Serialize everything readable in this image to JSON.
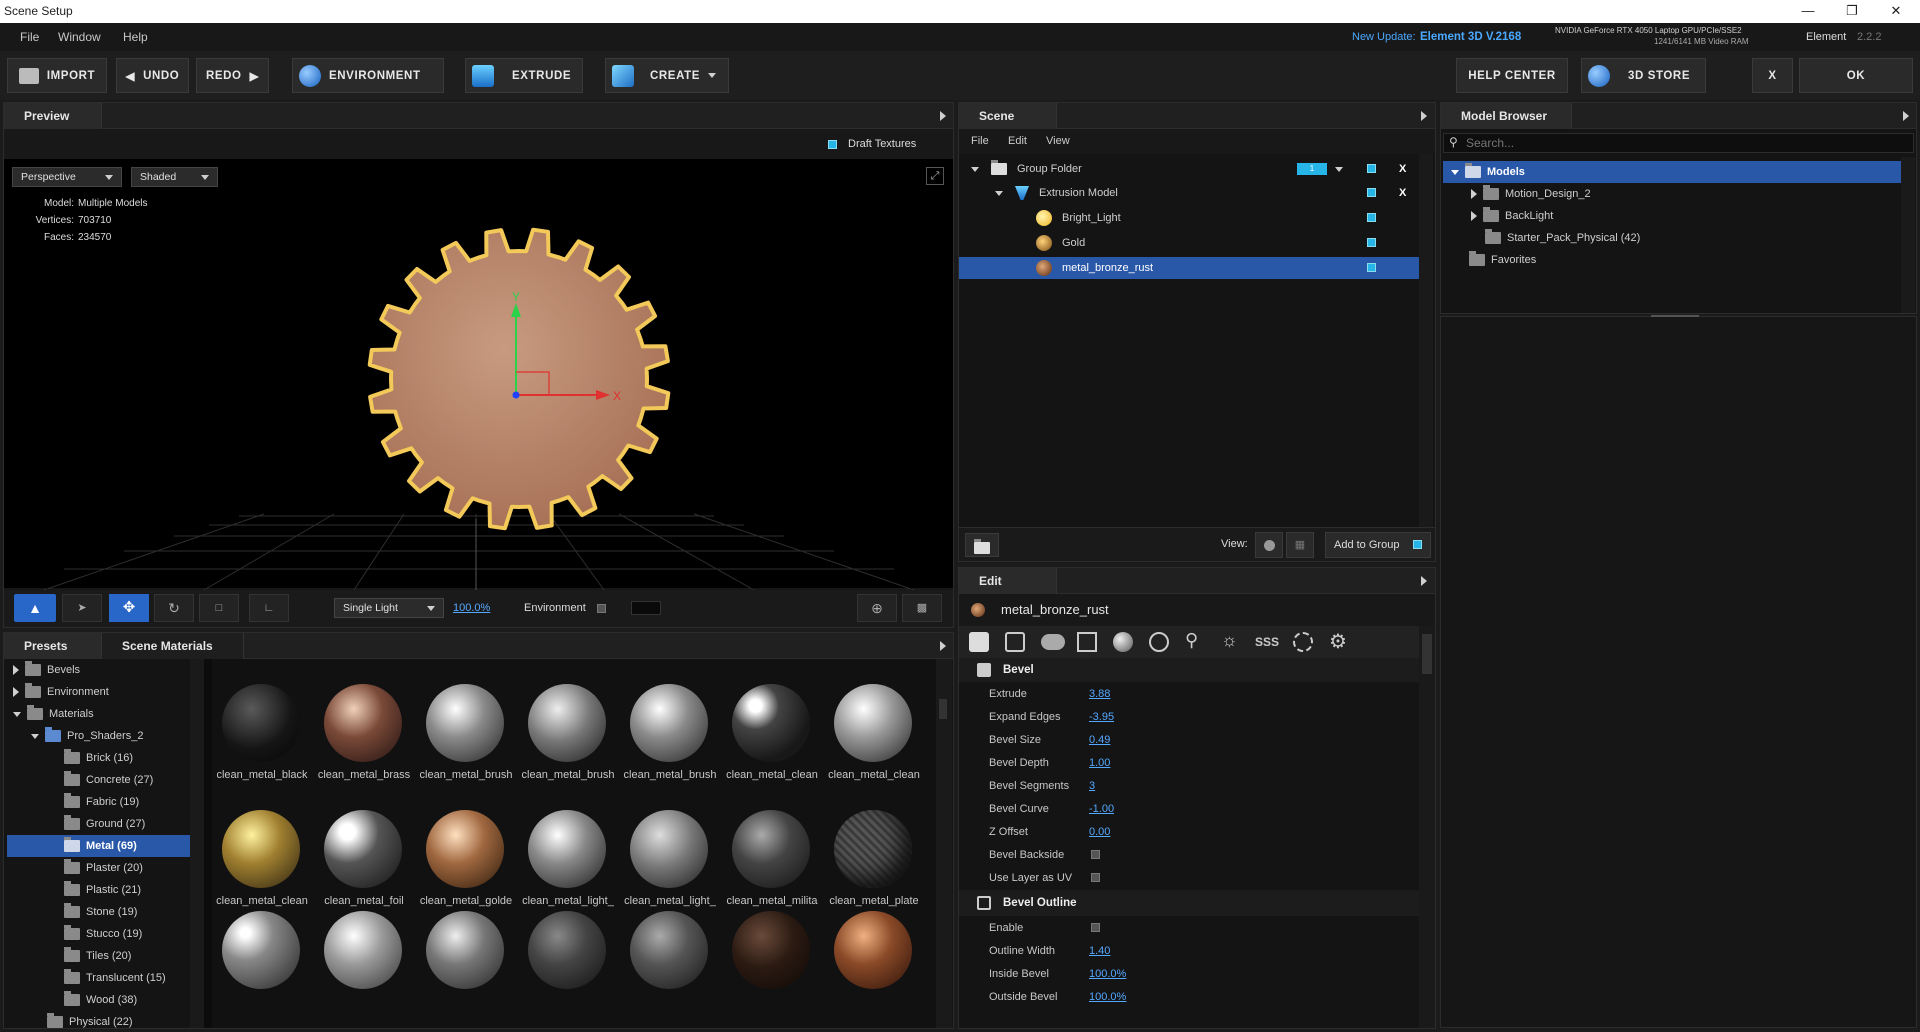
{
  "window": {
    "title": "Scene Setup"
  },
  "menu": {
    "items": [
      "File",
      "Window",
      "Help"
    ]
  },
  "update": {
    "label": "New Update:",
    "version": "Element 3D V.2168"
  },
  "gpu": {
    "line1": "NVIDIA GeForce RTX 4050 Laptop GPU/PCIe/SSE2",
    "line2": "1241/6141 MB Video RAM"
  },
  "app": {
    "name": "Element",
    "version": "2.2.2"
  },
  "toolbar": {
    "import": "IMPORT",
    "undo": "UNDO",
    "redo": "REDO",
    "environment": "ENVIRONMENT",
    "extrude": "EXTRUDE",
    "create": "CREATE",
    "help_center": "HELP CENTER",
    "store": "3D STORE",
    "close": "X",
    "ok": "OK"
  },
  "preview": {
    "tab": "Preview",
    "draft_textures": "Draft Textures",
    "camera": "Perspective",
    "shading": "Shaded",
    "model_label": "Model:",
    "model_value": "Multiple Models",
    "vertices_label": "Vertices:",
    "vertices_value": "703710",
    "faces_label": "Faces:",
    "faces_value": "234570",
    "axis_x": "X",
    "axis_y": "Y",
    "light_mode": "Single Light",
    "light_pct": "100.0%",
    "environment": "Environment"
  },
  "scene": {
    "tab": "Scene",
    "menu": [
      "File",
      "Edit",
      "View"
    ],
    "rows": [
      {
        "label": "Group Folder",
        "group_num": "1"
      },
      {
        "label": "Extrusion Model"
      },
      {
        "label": "Bright_Light"
      },
      {
        "label": "Gold"
      },
      {
        "label": "metal_bronze_rust"
      }
    ],
    "view_label": "View:",
    "add_to_group": "Add to Group"
  },
  "model_browser": {
    "tab": "Model Browser",
    "search_placeholder": "Search...",
    "items": [
      "Models",
      "Motion_Design_2",
      "BackLight",
      "Starter_Pack_Physical (42)",
      "Favorites"
    ]
  },
  "presets": {
    "tabs": [
      "Presets",
      "Scene Materials"
    ],
    "tree": [
      "Bevels",
      "Environment",
      "Materials",
      "Pro_Shaders_2",
      "Brick (16)",
      "Concrete (27)",
      "Fabric (19)",
      "Ground (27)",
      "Metal (69)",
      "Plaster (20)",
      "Plastic (21)",
      "Stone (19)",
      "Stucco (19)",
      "Tiles (20)",
      "Translucent (15)",
      "Wood (38)",
      "Physical (22)"
    ],
    "materials_row1": [
      "clean_metal_black",
      "clean_metal_brass",
      "clean_metal_brush",
      "clean_metal_brush",
      "clean_metal_brush",
      "clean_metal_clean",
      "clean_metal_clean"
    ],
    "materials_row2": [
      "clean_metal_clean",
      "clean_metal_foil",
      "clean_metal_golde",
      "clean_metal_light_",
      "clean_metal_light_",
      "clean_metal_milita",
      "clean_metal_plate"
    ]
  },
  "edit": {
    "tab": "Edit",
    "material": "metal_bronze_rust",
    "sss": "SSS",
    "bevel_header": "Bevel",
    "bevel_props": [
      {
        "k": "Extrude",
        "v": "3.88"
      },
      {
        "k": "Expand Edges",
        "v": "-3.95"
      },
      {
        "k": "Bevel Size",
        "v": "0.49"
      },
      {
        "k": "Bevel Depth",
        "v": "1.00"
      },
      {
        "k": "Bevel Segments",
        "v": "3"
      },
      {
        "k": "Bevel Curve",
        "v": "-1.00"
      },
      {
        "k": "Z Offset",
        "v": "0.00"
      },
      {
        "k": "Bevel Backside",
        "v": ""
      },
      {
        "k": "Use Layer as UV",
        "v": ""
      }
    ],
    "outline_header": "Bevel Outline",
    "outline_props": [
      {
        "k": "Enable",
        "v": ""
      },
      {
        "k": "Outline Width",
        "v": "1.40"
      },
      {
        "k": "Inside Bevel",
        "v": "100.0%"
      },
      {
        "k": "Outside Bevel",
        "v": "100.0%"
      }
    ]
  },
  "colors": {
    "accent": "#27b5e8",
    "selection": "#2a58a8",
    "link": "#55a8ff",
    "update": "#4aa8ff"
  }
}
